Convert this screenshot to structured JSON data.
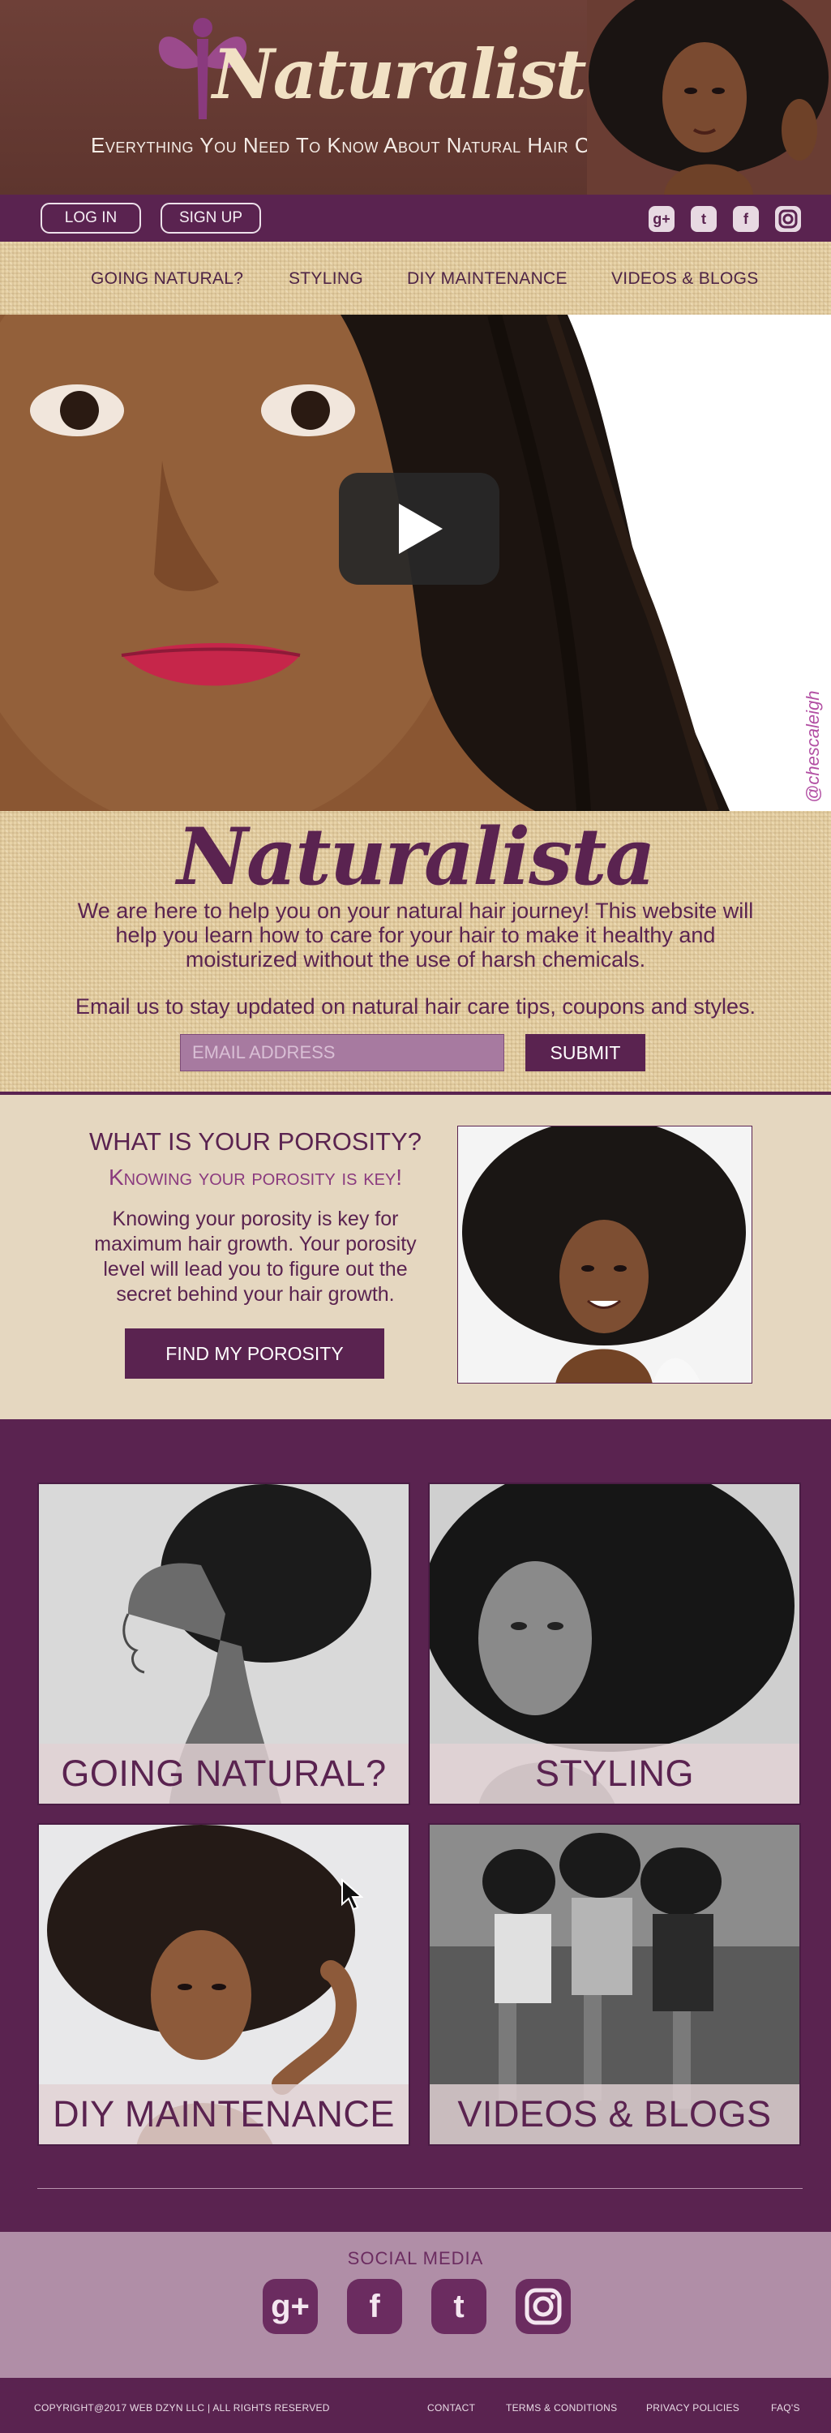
{
  "brand": {
    "logo_text": "Naturalista",
    "tagline": "Everything You Need To Know About Natural Hair Care"
  },
  "auth": {
    "login": "LOG IN",
    "signup": "SIGN UP"
  },
  "top_social": [
    "google-plus-icon",
    "twitter-icon",
    "facebook-icon",
    "instagram-icon"
  ],
  "nav": {
    "items": [
      "GOING NATURAL?",
      "STYLING",
      "DIY MAINTENANCE",
      "VIDEOS & BLOGS"
    ]
  },
  "video": {
    "credit": "@chescaleigh"
  },
  "intro": {
    "logo_text": "Naturalista",
    "text": "We are here to help you on your natural hair journey! This website will help you learn how to care for your hair to make it healthy and moisturized without the use of harsh chemicals.",
    "email_line": "Email us to stay updated on natural hair care tips, coupons and styles.",
    "email_placeholder": "EMAIL ADDRESS",
    "submit": "SUBMIT"
  },
  "porosity": {
    "title": "WHAT IS YOUR POROSITY?",
    "subtitle": "Knowing your porosity is key!",
    "text": "Knowing your porosity is key for maximum hair growth. Your porosity level will lead you to figure out the secret behind your hair growth.",
    "button": "FIND MY POROSITY"
  },
  "tiles": [
    {
      "label": "GOING NATURAL?"
    },
    {
      "label": "STYLING"
    },
    {
      "label": "DIY MAINTENANCE"
    },
    {
      "label": "VIDEOS & BLOGS"
    }
  ],
  "social": {
    "title": "SOCIAL MEDIA",
    "icons": [
      "google-plus-icon",
      "facebook-icon",
      "twitter-icon",
      "instagram-icon"
    ]
  },
  "footer": {
    "copyright": "COPYRIGHT@2017  WEB DZYN LLC  |  ALL RIGHTS RESERVED",
    "links": [
      "CONTACT",
      "TERMS & CONDITIONS",
      "PRIVACY POLICIES",
      "FAQ'S"
    ]
  },
  "colors": {
    "plum": "#5a2350",
    "header_brown": "#6e4038",
    "burlap": "#e8d3a8",
    "sand": "#e5d7c0",
    "mauve": "#b08ea7"
  }
}
